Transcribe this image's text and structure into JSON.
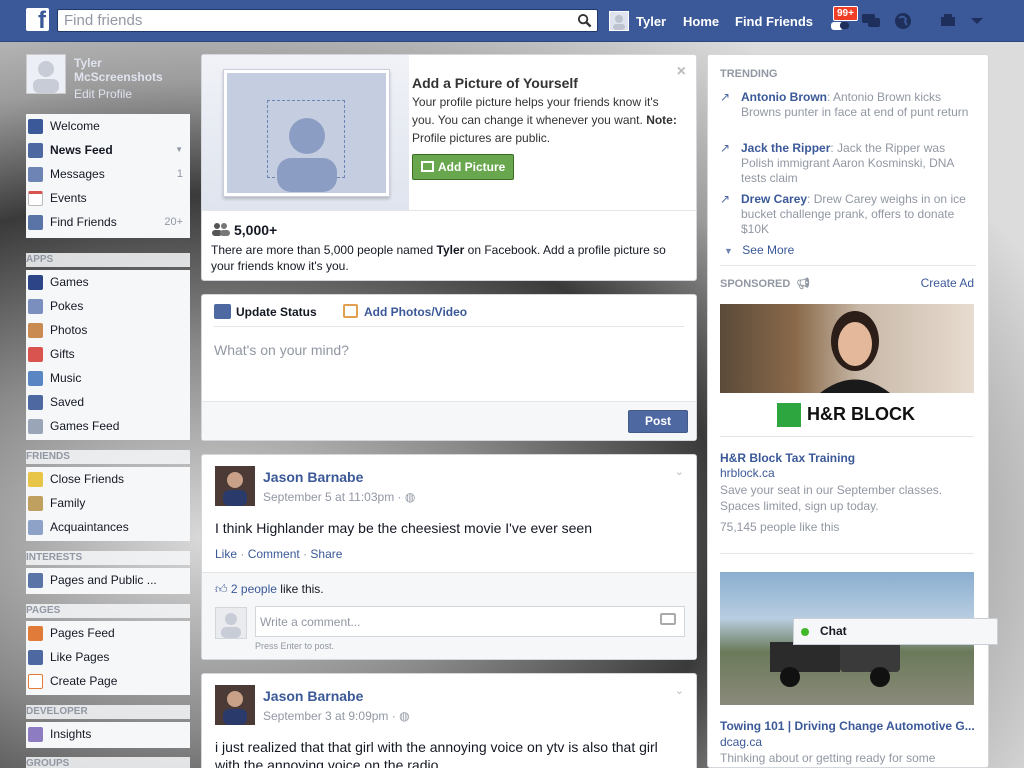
{
  "header": {
    "search_placeholder": "Find friends",
    "user_name": "Tyler",
    "home": "Home",
    "find_friends": "Find Friends",
    "notif_badge": "99+"
  },
  "profile": {
    "name": "Tyler McScreenshots",
    "edit": "Edit Profile"
  },
  "nav": {
    "favorites": [
      {
        "label": "Welcome",
        "count": ""
      },
      {
        "label": "News Feed",
        "count": ""
      },
      {
        "label": "Messages",
        "count": "1"
      },
      {
        "label": "Events",
        "count": ""
      },
      {
        "label": "Find Friends",
        "count": "20+"
      }
    ],
    "apps_head": "APPS",
    "apps": [
      "Games",
      "Pokes",
      "Photos",
      "Gifts",
      "Music",
      "Saved",
      "Games Feed"
    ],
    "friends_head": "FRIENDS",
    "friends": [
      "Close Friends",
      "Family",
      "Acquaintances"
    ],
    "interests_head": "INTERESTS",
    "interests": [
      "Pages and Public ..."
    ],
    "pages_head": "PAGES",
    "pages": [
      "Pages Feed",
      "Like Pages",
      "Create Page"
    ],
    "developer_head": "DEVELOPER",
    "developer": [
      "Insights"
    ],
    "groups_head": "GROUPS"
  },
  "addpic": {
    "title": "Add a Picture of Yourself",
    "desc": "Your profile picture helps your friends know it's you. You can change it whenever you want.",
    "note_label": "Note:",
    "note_text": "Profile pictures are public.",
    "button": "Add Picture",
    "count": "5,000+",
    "named_prefix": "There are more than 5,000 people named",
    "named_name": "Tyler",
    "named_suffix": "on Facebook. Add a profile picture so your friends know it's you."
  },
  "composer": {
    "tab_status": "Update Status",
    "tab_photos": "Add Photos/Video",
    "placeholder": "What's on your mind?",
    "post": "Post"
  },
  "posts": [
    {
      "author": "Jason Barnabe",
      "time": "September 5 at 11:03pm",
      "text": "I think Highlander may be the cheesiest movie I've ever seen",
      "like": "Like",
      "comment": "Comment",
      "share": "Share",
      "likes_link": "2 people",
      "likes_suffix": "like this.",
      "comment_placeholder": "Write a comment...",
      "enter_hint": "Press Enter to post."
    },
    {
      "author": "Jason Barnabe",
      "time": "September 3 at 9:09pm",
      "text": "i just realized that that girl with the annoying voice on ytv is also that girl with the annoying voice on the radio"
    }
  ],
  "trending": {
    "head": "TRENDING",
    "items": [
      {
        "name": "Antonio Brown",
        "text": ": Antonio Brown kicks Browns punter in face at end of punt return"
      },
      {
        "name": "Jack the Ripper",
        "text": ": Jack the Ripper was Polish immigrant Aaron Kosminski, DNA tests claim"
      },
      {
        "name": "Drew Carey",
        "text": ": Drew Carey weighs in on ice bucket challenge prank, offers to donate $10K"
      }
    ],
    "see_more": "See More"
  },
  "sponsored": {
    "head": "SPONSORED",
    "create_ad": "Create Ad",
    "ads": [
      {
        "brand": "H&R BLOCK",
        "title": "H&R Block Tax Training",
        "domain": "hrblock.ca",
        "desc": "Save your seat in our September classes. Spaces limited, sign up today.",
        "likes": "75,145 people like this"
      },
      {
        "title": "Towing 101 | Driving Change Automotive G...",
        "domain": "dcag.ca",
        "desc": "Thinking about or getting ready for some"
      }
    ]
  },
  "chat": {
    "label": "Chat"
  },
  "colors": {
    "brand": "#3b5998",
    "green": "#69a74e",
    "badge": "#f03d25"
  }
}
